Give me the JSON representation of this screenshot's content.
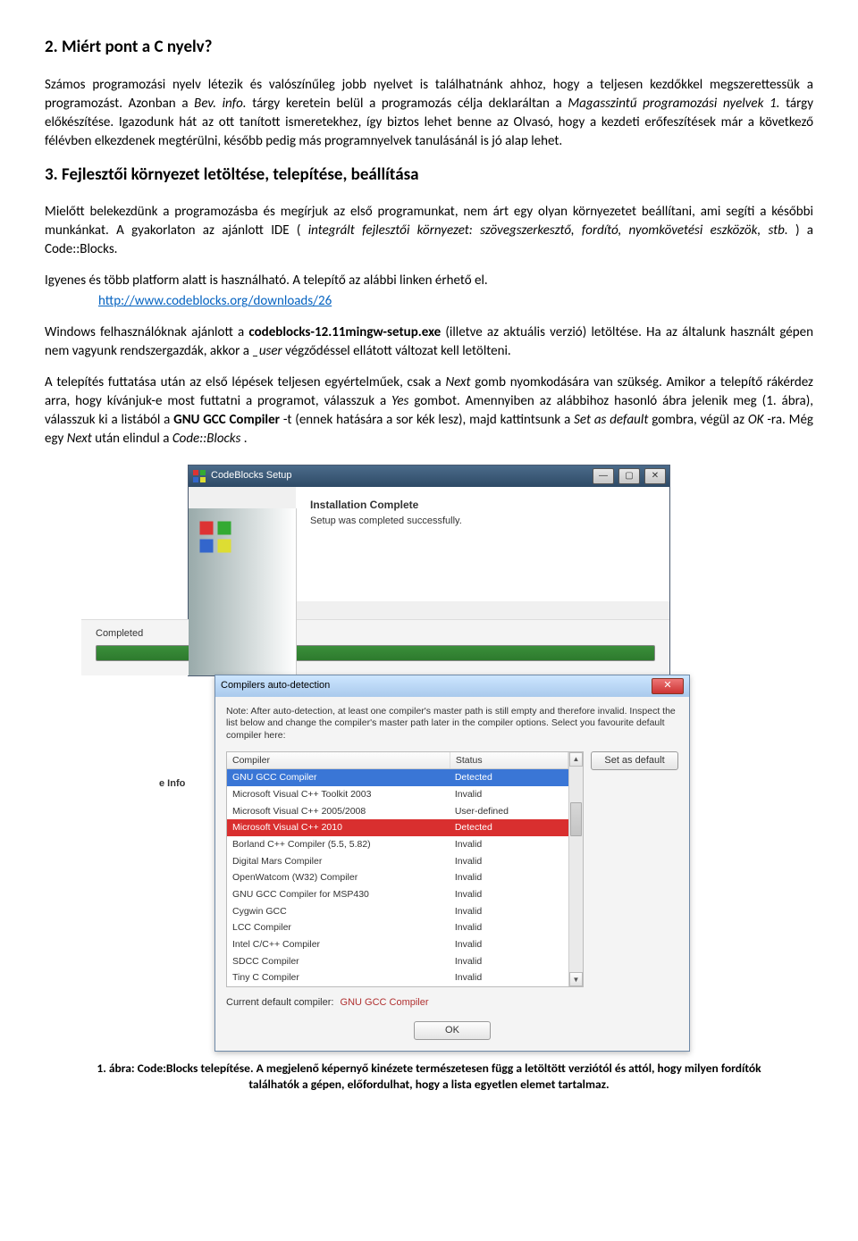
{
  "sections": {
    "s2_title": "2.   Miért pont a C nyelv?",
    "s2_p1_a": "Számos programozási nyelv létezik és valószínűleg jobb nyelvet is találhatnánk ahhoz, hogy a teljesen kezdőkkel megszerettessük a programozást. Azonban a ",
    "s2_p1_b": "Bev. info.",
    "s2_p1_c": " tárgy keretein belül a programozás célja deklaráltan a ",
    "s2_p1_d": "Magasszintű programozási nyelvek 1.",
    "s2_p1_e": " tárgy előkészítése. Igazodunk hát az ott tanított ismeretekhez, így biztos lehet benne az Olvasó, hogy a kezdeti erőfeszítések már a következő félévben elkezdenek megtérülni, később pedig más programnyelvek tanulásánál is jó alap lehet.",
    "s3_title": "3.   Fejlesztői környezet letöltése, telepítése, beállítása",
    "s3_p1_a": "Mielőtt belekezdünk a programozásba és megírjuk az első programunkat, nem árt egy olyan környezetet beállítani, ami segíti a későbbi munkánkat. A gyakorlaton az ajánlott IDE (",
    "s3_p1_b": "integrált fejlesztői környezet: szövegszerkesztő, fordító, nyomkövetési eszközök, stb.",
    "s3_p1_c": ") a Code::Blocks.",
    "s3_p2": "Igyenes és több platform alatt is használható. A telepítő az alábbi linken érhető el.",
    "link_text": "http://www.codeblocks.org/downloads/26",
    "s3_p3_a": "Windows felhasználóknak ajánlott a ",
    "s3_p3_b": "codeblocks-12.11mingw-setup.exe",
    "s3_p3_c": " (illetve az aktuális verzió) letöltése. Ha az általunk használt gépen nem vagyunk rendszergazdák, akkor a ",
    "s3_p3_d": "_user",
    "s3_p3_e": " végződéssel ellátott változat kell letölteni.",
    "s3_p4_a": "A telepítés futtatása után az első lépések teljesen egyértelműek, csak a ",
    "s3_p4_b": "Next",
    "s3_p4_c": " gomb nyomkodására van szükség. Amikor a telepítő rákérdez arra, hogy kívánjuk-e most futtatni a programot, válasszuk a ",
    "s3_p4_d": "Yes",
    "s3_p4_e": " gombot. Amennyiben az alábbihoz hasonló ábra jelenik meg (1. ábra), válasszuk ki a listából a ",
    "s3_p4_f": "GNU GCC Compiler",
    "s3_p4_g": "-t (ennek hatására a sor kék lesz), majd kattintsunk a ",
    "s3_p4_h": "Set as default",
    "s3_p4_i": " gombra, végül az ",
    "s3_p4_j": "OK",
    "s3_p4_k": "-ra. Még egy ",
    "s3_p4_l": "Next",
    "s3_p4_m": " után elindul a ",
    "s3_p4_n": "Code::Blocks",
    "s3_p4_o": "."
  },
  "caption": "1. ábra: Code:Blocks telepítése. A megjelenő képernyő kinézete természetesen függ a letöltött verziótól és attól, hogy milyen fordítók találhatók a gépen, előfordulhat, hogy a lista egyetlen elemet tartalmaz.",
  "installer": {
    "title": "CodeBlocks Setup",
    "heading": "Installation Complete",
    "subtext": "Setup was completed successfully.",
    "progress_label": "Completed",
    "left_edge": "e Info"
  },
  "dialog": {
    "title": "Compilers auto-detection",
    "note": "Note: After auto-detection, at least one compiler's master path is still empty and therefore invalid. Inspect the list below and change the compiler's master path later in the compiler options. Select you favourite default compiler here:",
    "col1": "Compiler",
    "col2": "Status",
    "set_default_btn": "Set as default",
    "current_default_label": "Current default compiler:",
    "current_default_value": "GNU GCC Compiler",
    "ok_btn": "OK",
    "rows": [
      {
        "name": "GNU GCC Compiler",
        "status": "Detected",
        "kind": "blue"
      },
      {
        "name": "Microsoft Visual C++ Toolkit 2003",
        "status": "Invalid",
        "kind": ""
      },
      {
        "name": "Microsoft Visual C++ 2005/2008",
        "status": "User-defined",
        "kind": ""
      },
      {
        "name": "Microsoft Visual C++ 2010",
        "status": "Detected",
        "kind": "red"
      },
      {
        "name": "Borland C++ Compiler (5.5, 5.82)",
        "status": "Invalid",
        "kind": ""
      },
      {
        "name": "Digital Mars Compiler",
        "status": "Invalid",
        "kind": ""
      },
      {
        "name": "OpenWatcom (W32) Compiler",
        "status": "Invalid",
        "kind": ""
      },
      {
        "name": "GNU GCC Compiler for MSP430",
        "status": "Invalid",
        "kind": ""
      },
      {
        "name": "Cygwin GCC",
        "status": "Invalid",
        "kind": ""
      },
      {
        "name": "LCC Compiler",
        "status": "Invalid",
        "kind": ""
      },
      {
        "name": "Intel C/C++ Compiler",
        "status": "Invalid",
        "kind": ""
      },
      {
        "name": "SDCC Compiler",
        "status": "Invalid",
        "kind": ""
      },
      {
        "name": "Tiny C Compiler",
        "status": "Invalid",
        "kind": ""
      }
    ]
  }
}
